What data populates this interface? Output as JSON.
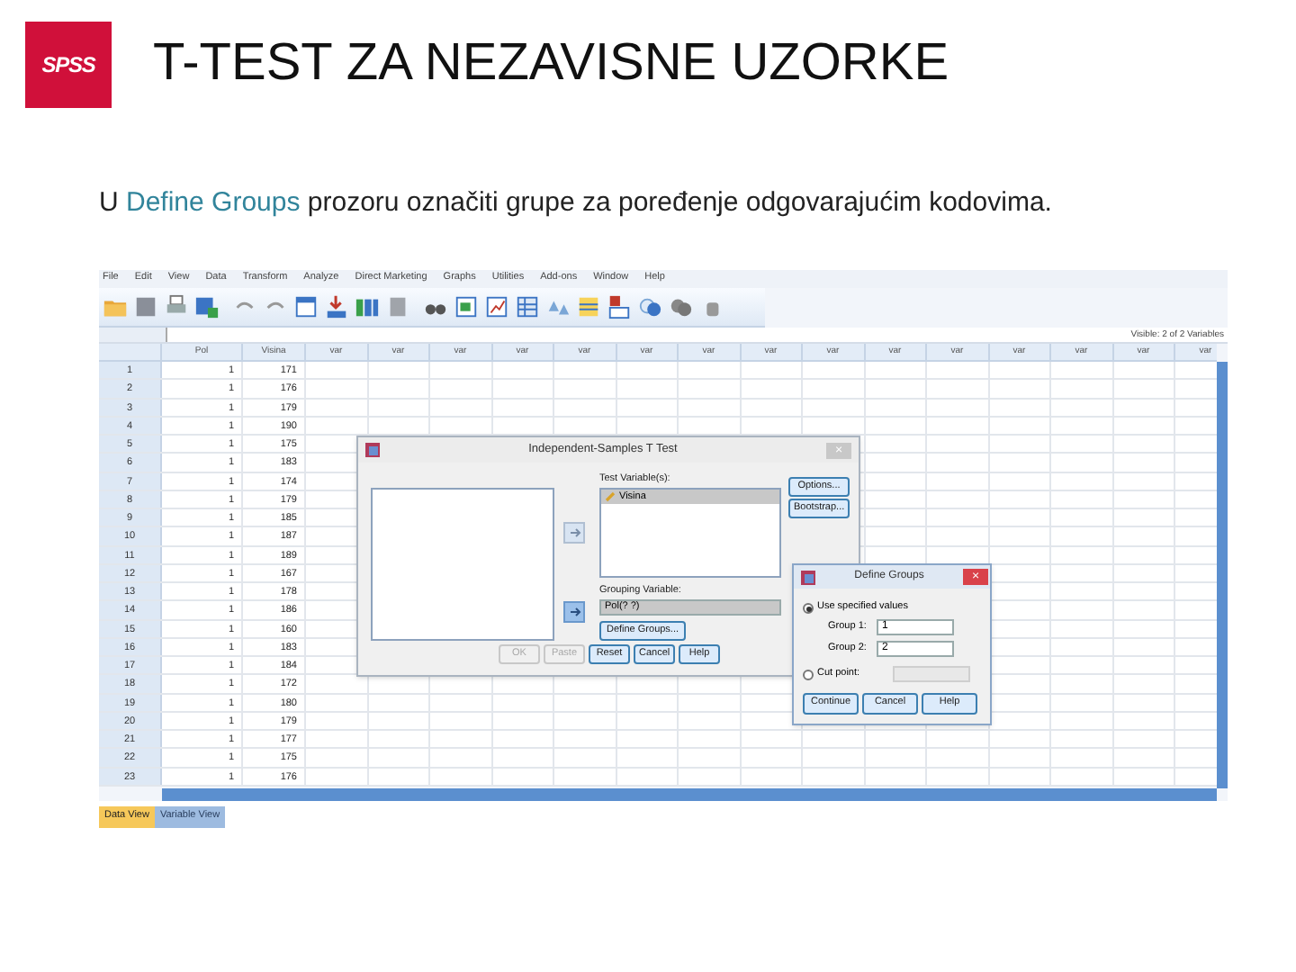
{
  "logo": {
    "text": "SPSS"
  },
  "title": "T-TEST ZA NEZAVISNE UZORKE",
  "instruction": {
    "before": "U ",
    "highlight": "Define Groups",
    "after": " prozoru označiti grupe za poređenje odgovarajućim kodovima."
  },
  "spss_window": {
    "menu": [
      "File",
      "Edit",
      "View",
      "Data",
      "Transform",
      "Analyze",
      "Direct Marketing",
      "Graphs",
      "Utilities",
      "Add-ons",
      "Window",
      "Help"
    ],
    "visible_info": "Visible: 2 of 2 Variables",
    "columns": [
      "Pol",
      "Visina",
      "var",
      "var",
      "var",
      "var",
      "var",
      "var",
      "var",
      "var",
      "var",
      "var",
      "var",
      "var",
      "var",
      "var",
      "var"
    ],
    "rows": [
      {
        "number": "1",
        "cells": [
          "1",
          "171"
        ]
      },
      {
        "number": "2",
        "cells": [
          "1",
          "176"
        ]
      },
      {
        "number": "3",
        "cells": [
          "1",
          "179"
        ]
      },
      {
        "number": "4",
        "cells": [
          "1",
          "190"
        ]
      },
      {
        "number": "5",
        "cells": [
          "1",
          "175"
        ]
      },
      {
        "number": "6",
        "cells": [
          "1",
          "183"
        ]
      },
      {
        "number": "7",
        "cells": [
          "1",
          "174"
        ]
      },
      {
        "number": "8",
        "cells": [
          "1",
          "179"
        ]
      },
      {
        "number": "9",
        "cells": [
          "1",
          "185"
        ]
      },
      {
        "number": "10",
        "cells": [
          "1",
          "187"
        ]
      },
      {
        "number": "11",
        "cells": [
          "1",
          "189"
        ]
      },
      {
        "number": "12",
        "cells": [
          "1",
          "167"
        ]
      },
      {
        "number": "13",
        "cells": [
          "1",
          "178"
        ]
      },
      {
        "number": "14",
        "cells": [
          "1",
          "186"
        ]
      },
      {
        "number": "15",
        "cells": [
          "1",
          "160"
        ]
      },
      {
        "number": "16",
        "cells": [
          "1",
          "183"
        ]
      },
      {
        "number": "17",
        "cells": [
          "1",
          "184"
        ]
      },
      {
        "number": "18",
        "cells": [
          "1",
          "172"
        ]
      },
      {
        "number": "19",
        "cells": [
          "1",
          "180"
        ]
      },
      {
        "number": "20",
        "cells": [
          "1",
          "179"
        ]
      },
      {
        "number": "21",
        "cells": [
          "1",
          "177"
        ]
      },
      {
        "number": "22",
        "cells": [
          "1",
          "175"
        ]
      },
      {
        "number": "23",
        "cells": [
          "1",
          "176"
        ]
      }
    ],
    "view_tabs": [
      {
        "label": "Data View",
        "selected": true
      },
      {
        "label": "Variable View",
        "selected": false
      }
    ],
    "ttest_dialog": {
      "title": "Independent-Samples T Test",
      "close": "×",
      "test_variables_label": "Test Variable(s):",
      "test_variables": [
        {
          "label": "Visina",
          "selected": true
        }
      ],
      "side_buttons": [
        "Options...",
        "Bootstrap..."
      ],
      "grouping_label": "Grouping Variable:",
      "grouping_value": "Pol(? ?)",
      "define_button": "Define Groups...",
      "buttons": [
        {
          "label": "OK",
          "disabled": true
        },
        {
          "label": "Paste",
          "disabled": true
        },
        {
          "label": "Reset",
          "disabled": false
        },
        {
          "label": "Cancel",
          "disabled": false
        },
        {
          "label": "Help",
          "disabled": false
        }
      ]
    },
    "define_groups_dialog": {
      "title": "Define Groups",
      "close": "×",
      "options": [
        {
          "label": "Use specified values",
          "selected": true
        },
        {
          "label": "Cut point:",
          "selected": false
        }
      ],
      "groups": [
        {
          "label": "Group 1:",
          "value": "1"
        },
        {
          "label": "Group 2:",
          "value": "2"
        }
      ],
      "cut_point_field": {
        "disabled": true
      },
      "buttons": [
        "Continue",
        "Cancel",
        "Help"
      ]
    }
  }
}
